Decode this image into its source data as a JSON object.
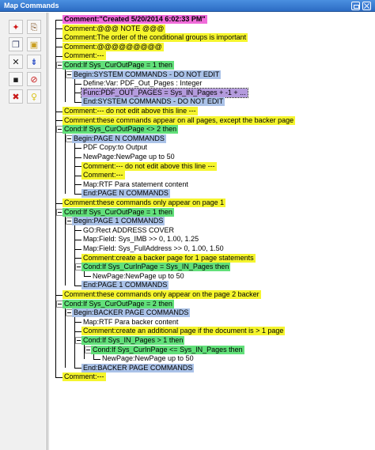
{
  "window": {
    "title": "Map Commands"
  },
  "toolbar": {
    "buttons": [
      {
        "name": "add-command-button",
        "icon": "red-star-icon",
        "glyph": "✦",
        "color": "#d01818"
      },
      {
        "name": "import-button",
        "icon": "document-import-icon",
        "glyph": "⎘",
        "color": "#7a4a1a"
      },
      {
        "name": "copy-button",
        "icon": "copy-icon",
        "glyph": "❐",
        "color": "#404a70"
      },
      {
        "name": "open-folder-button",
        "icon": "folder-open-icon",
        "glyph": "▣",
        "color": "#c99e20"
      },
      {
        "name": "delete-button",
        "icon": "x-icon",
        "glyph": "✕",
        "color": "#202020"
      },
      {
        "name": "move-down-button",
        "icon": "move-down-icon",
        "glyph": "⇟",
        "color": "#1a3fc2"
      },
      {
        "name": "save-button",
        "icon": "save-disk-icon",
        "glyph": "▪",
        "color": "#202020"
      },
      {
        "name": "disable-button",
        "icon": "no-entry-icon",
        "glyph": "⊘",
        "color": "#c81818"
      },
      {
        "name": "remove-red-button",
        "icon": "red-x-icon",
        "glyph": "✖",
        "color": "#c81818"
      },
      {
        "name": "help-tip-button",
        "icon": "lightbulb-icon",
        "glyph": "♀",
        "color": "#d9c21a"
      }
    ]
  },
  "tree": [
    {
      "text": "Comment:\"Created 5/20/2014 6:02:33 PM\"",
      "level": 0,
      "hl": "pink"
    },
    {
      "text": "Comment:@@@ NOTE @@@",
      "level": 0,
      "hl": "yellow"
    },
    {
      "text": "Comment:The order of the conditional groups is important",
      "level": 0,
      "hl": "yellow"
    },
    {
      "text": "Comment:@@@@@@@@@",
      "level": 0,
      "hl": "yellow"
    },
    {
      "text": "Comment:---",
      "level": 0,
      "hl": "yellow"
    },
    {
      "text": "Cond:If Sys_CurOutPage = 1 then",
      "level": 0,
      "hl": "green",
      "toggle": true
    },
    {
      "text": "Begin:SYSTEM COMMANDS - DO NOT EDIT",
      "level": 1,
      "hl": "blue",
      "toggle": true
    },
    {
      "text": "Define:Var: PDF_Out_Pages : Integer",
      "level": 2,
      "hl": "none"
    },
    {
      "text": "Func:PDF_OUT_PAGES = Sys_IN_Pages + -1 + ...",
      "level": 2,
      "hl": "purple",
      "selected": true
    },
    {
      "text": "End:SYSTEM COMMANDS - DO NOT EDIT",
      "level": 2,
      "hl": "blue"
    },
    {
      "text": "Comment:--- do not edit above this line ---",
      "level": 0,
      "hl": "yellow"
    },
    {
      "text": "Comment:these commands appear on all pages, except the backer page",
      "level": 0,
      "hl": "yellow"
    },
    {
      "text": "Cond:If Sys_CurOutPage <> 2 then",
      "level": 0,
      "hl": "green",
      "toggle": true
    },
    {
      "text": "Begin:PAGE N COMMANDS",
      "level": 1,
      "hl": "blue",
      "toggle": true
    },
    {
      "text": "PDF Copy:to Output",
      "level": 2,
      "hl": "none"
    },
    {
      "text": "NewPage:NewPage up to 50",
      "level": 2,
      "hl": "none"
    },
    {
      "text": "Comment:--- do not edit above this line ---",
      "level": 2,
      "hl": "yellow"
    },
    {
      "text": "Comment:---",
      "level": 2,
      "hl": "yellow"
    },
    {
      "text": "Map:RTF Para statement content",
      "level": 2,
      "hl": "none"
    },
    {
      "text": "End:PAGE N COMMANDS",
      "level": 2,
      "hl": "blue"
    },
    {
      "text": "Comment:these commands only appear on page 1",
      "level": 0,
      "hl": "yellow"
    },
    {
      "text": "Cond:If Sys_CurOutPage = 1 then",
      "level": 0,
      "hl": "green",
      "toggle": true
    },
    {
      "text": "Begin:PAGE 1 COMMANDS",
      "level": 1,
      "hl": "blue",
      "toggle": true
    },
    {
      "text": "GO:Rect ADDRESS COVER",
      "level": 2,
      "hl": "none"
    },
    {
      "text": "Map:Field:  Sys_IMB >>       0, 1.00, 1.25",
      "level": 2,
      "hl": "none"
    },
    {
      "text": "Map:Field:  Sys_FullAddress >>       0, 1.00, 1.50",
      "level": 2,
      "hl": "none"
    },
    {
      "text": "Comment:create a backer page for 1 page statements",
      "level": 2,
      "hl": "yellow"
    },
    {
      "text": "Cond:If Sys_CurInPage = Sys_IN_Pages then",
      "level": 2,
      "hl": "green",
      "toggle": true
    },
    {
      "text": "NewPage:NewPage up to 50",
      "level": 3,
      "hl": "none"
    },
    {
      "text": "End:PAGE 1 COMMANDS",
      "level": 2,
      "hl": "blue"
    },
    {
      "text": "Comment:these commands only appear on the page 2 backer",
      "level": 0,
      "hl": "yellow"
    },
    {
      "text": "Cond:If Sys_CurOutPage = 2 then",
      "level": 0,
      "hl": "green",
      "toggle": true
    },
    {
      "text": "Begin:BACKER PAGE COMMANDS",
      "level": 1,
      "hl": "blue",
      "toggle": true
    },
    {
      "text": "Map:RTF Para backer content",
      "level": 2,
      "hl": "none"
    },
    {
      "text": "Comment:create an additional page if the document is > 1 page",
      "level": 2,
      "hl": "yellow"
    },
    {
      "text": "Cond:If Sys_IN_Pages > 1 then",
      "level": 2,
      "hl": "green",
      "toggle": true
    },
    {
      "text": "Cond:If Sys_CurInPage <= Sys_IN_Pages then",
      "level": 3,
      "hl": "green",
      "toggle": true
    },
    {
      "text": "NewPage:NewPage up to 50",
      "level": 4,
      "hl": "none"
    },
    {
      "text": "End:BACKER PAGE COMMANDS",
      "level": 2,
      "hl": "blue"
    },
    {
      "text": "Comment:---",
      "level": 0,
      "hl": "yellow"
    }
  ]
}
